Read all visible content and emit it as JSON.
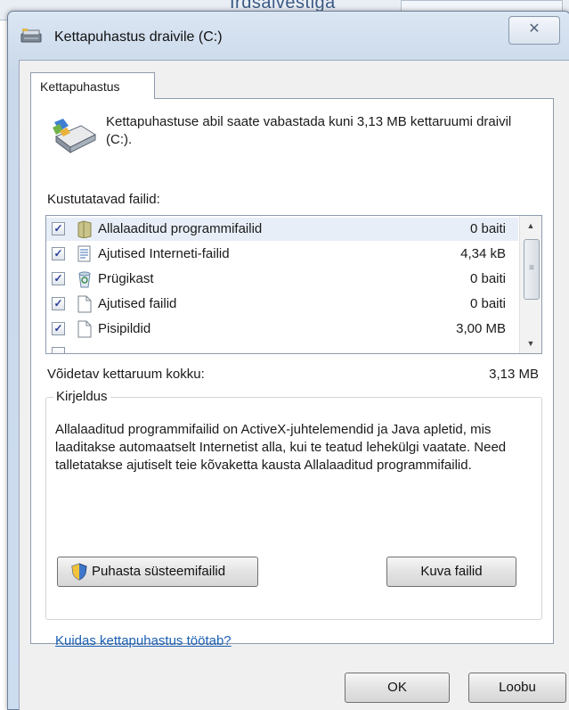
{
  "background": {
    "partial_text": "Irdsalvestiga"
  },
  "window": {
    "title": "Kettapuhastus draivile  (C:)",
    "close_symbol": "✕"
  },
  "tab": {
    "label": "Kettapuhastus"
  },
  "intro": {
    "text": "Kettapuhastuse abil saate vabastada kuni 3,13 MB kettaruumi draivil  (C:)."
  },
  "files": {
    "label": "Kustutatavad failid:",
    "items": [
      {
        "name": "Allalaaditud programmifailid",
        "size": "0 baiti",
        "checked": true,
        "selected": true,
        "icon": "folder-icon"
      },
      {
        "name": "Ajutised Interneti-failid",
        "size": "4,34 kB",
        "checked": true,
        "selected": false,
        "icon": "document-lines-icon"
      },
      {
        "name": "Prügikast",
        "size": "0 baiti",
        "checked": true,
        "selected": false,
        "icon": "recycle-bin-icon"
      },
      {
        "name": "Ajutised failid",
        "size": "0 baiti",
        "checked": true,
        "selected": false,
        "icon": "blank-file-icon"
      },
      {
        "name": "Pisipildid",
        "size": "3,00 MB",
        "checked": true,
        "selected": false,
        "icon": "blank-file-icon"
      }
    ],
    "check_mark": "✓"
  },
  "total": {
    "label": "Võidetav kettaruum kokku:",
    "value": "3,13 MB"
  },
  "description": {
    "title": "Kirjeldus",
    "text": "Allalaaditud programmifailid on ActiveX-juhtelemendid ja Java apletid, mis laaditakse automaatselt Internetist alla, kui te teatud lehekülgi vaatate. Need talletatakse ajutiselt teie kõvaketta kausta Allalaaditud programmifailid."
  },
  "buttons": {
    "clean_system": "Puhasta süsteemifailid",
    "view_files": "Kuva failid",
    "ok": "OK",
    "cancel": "Loobu"
  },
  "help_link": "Kuidas kettapuhastus töötab?",
  "colors": {
    "link": "#1a5fb4",
    "title_bar": "#c9d8ea",
    "selection": "#e8eef7"
  }
}
